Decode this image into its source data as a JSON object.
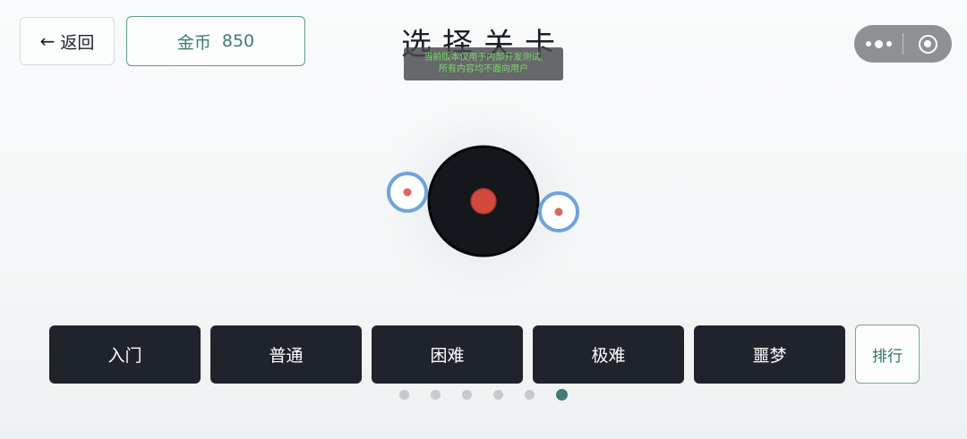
{
  "header": {
    "back_label": "返回",
    "coins_label": "金币",
    "coins_value": "850",
    "title": "选择关卡",
    "dev_notice_line1": "当前版本仅用于内部开发测试,",
    "dev_notice_line2": "所有内容均不面向用户"
  },
  "capsule": {
    "more_icon": "more-dots-icon",
    "close_icon": "target-icon"
  },
  "levels": [
    {
      "label": "入门"
    },
    {
      "label": "普通"
    },
    {
      "label": "困难"
    },
    {
      "label": "极难"
    },
    {
      "label": "噩梦"
    }
  ],
  "rank_label": "排行",
  "pager": {
    "count": 6,
    "active_index": 5
  },
  "colors": {
    "accent": "#3f7d72",
    "button_dark": "#1f232b",
    "disc": "#15171c",
    "core_red": "#d24a3d",
    "orbit_blue": "#6fa3dc"
  }
}
